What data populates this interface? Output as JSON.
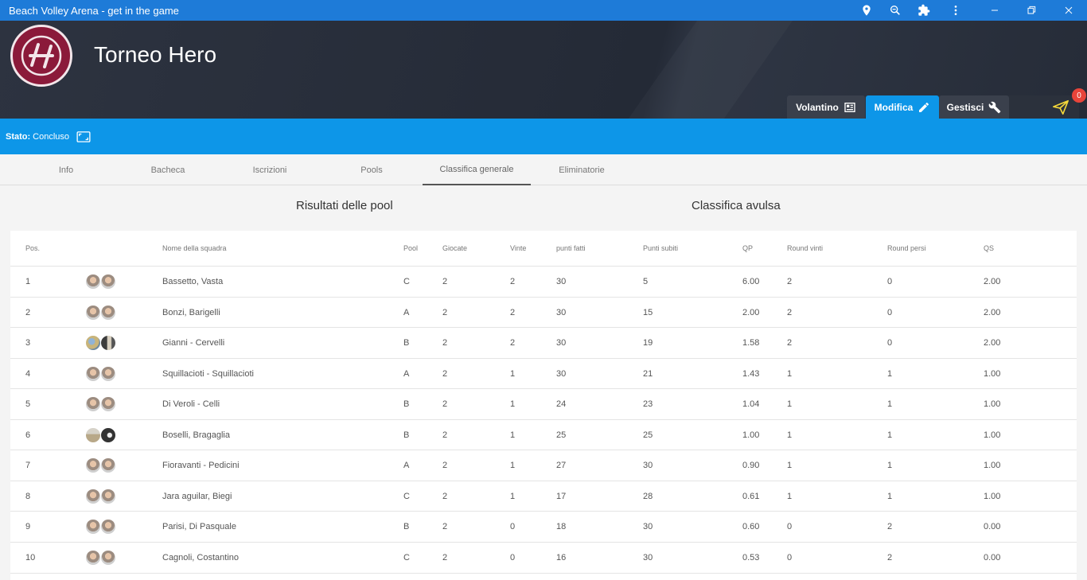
{
  "window": {
    "title": "Beach Volley Arena - get in the game",
    "icons": [
      "location-pin-icon",
      "zoom-icon",
      "extensions-icon",
      "more-vert-icon",
      "minimize-icon",
      "restore-icon",
      "close-icon"
    ]
  },
  "header": {
    "title": "Torneo Hero",
    "buttons": {
      "volantino": "Volantino",
      "modifica": "Modifica",
      "gestisci": "Gestisci"
    },
    "notification_count": "0",
    "colors": {
      "accent": "#0d96e8",
      "badge": "#e8443a",
      "logo": "#8b1a3a"
    }
  },
  "status": {
    "label": "Stato:",
    "value": "Concluso"
  },
  "tabs": [
    "Info",
    "Bacheca",
    "Iscrizioni",
    "Pools",
    "Classifica generale",
    "Eliminatorie"
  ],
  "active_tab": "Classifica generale",
  "sections": {
    "left": "Risultati delle pool",
    "right": "Classifica avulsa"
  },
  "table": {
    "headers": [
      "Pos.",
      "Nome della squadra",
      "Pool",
      "Giocate",
      "Vinte",
      "punti fatti",
      "Punti subiti",
      "QP",
      "Round vinti",
      "Round persi",
      "QS"
    ],
    "rows": [
      [
        "1",
        "Bassetto, Vasta",
        "C",
        "2",
        "2",
        "30",
        "5",
        "6.00",
        "2",
        "0",
        "2.00"
      ],
      [
        "2",
        "Bonzi, Barigelli",
        "A",
        "2",
        "2",
        "30",
        "15",
        "2.00",
        "2",
        "0",
        "2.00"
      ],
      [
        "3",
        "Gianni - Cervelli",
        "B",
        "2",
        "2",
        "30",
        "19",
        "1.58",
        "2",
        "0",
        "2.00"
      ],
      [
        "4",
        "Squillacioti - Squillacioti",
        "A",
        "2",
        "1",
        "30",
        "21",
        "1.43",
        "1",
        "1",
        "1.00"
      ],
      [
        "5",
        "Di Veroli - Celli",
        "B",
        "2",
        "1",
        "24",
        "23",
        "1.04",
        "1",
        "1",
        "1.00"
      ],
      [
        "6",
        "Boselli, Bragaglia",
        "B",
        "2",
        "1",
        "25",
        "25",
        "1.00",
        "1",
        "1",
        "1.00"
      ],
      [
        "7",
        "Fioravanti - Pedicini",
        "A",
        "2",
        "1",
        "27",
        "30",
        "0.90",
        "1",
        "1",
        "1.00"
      ],
      [
        "8",
        "Jara aguilar, Biegi",
        "C",
        "2",
        "1",
        "17",
        "28",
        "0.61",
        "1",
        "1",
        "1.00"
      ],
      [
        "9",
        "Parisi, Di Pasquale",
        "B",
        "2",
        "0",
        "18",
        "30",
        "0.60",
        "0",
        "2",
        "0.00"
      ],
      [
        "10",
        "Cagnoli, Costantino",
        "C",
        "2",
        "0",
        "16",
        "30",
        "0.53",
        "0",
        "2",
        "0.00"
      ]
    ]
  }
}
